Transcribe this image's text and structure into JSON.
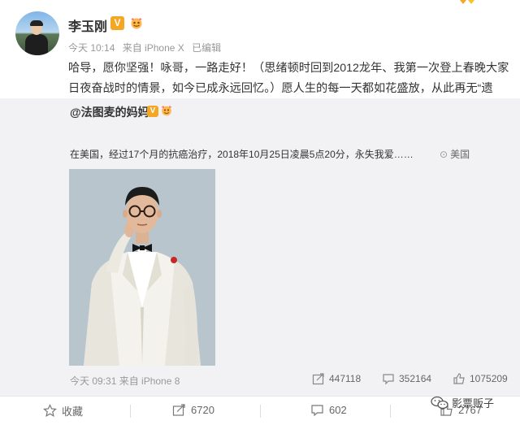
{
  "post": {
    "author": "李玉刚",
    "meta": {
      "time": "今天 10:14",
      "source": "来自 iPhone X",
      "edited": "已编辑"
    },
    "text": "哈导，愿你坚强！咏哥，一路走好！（思绪顿时回到2012龙年、我第一次登上春晚大家日夜奋战时的情景，如今已成永远回忆。）愿人生的每一天都如花盛放，从此再无“遗憾”二字。感恩所有！",
    "emojis": [
      "cry-emoji",
      "weep-emoji",
      "heart-emoji",
      "candle-emoji",
      "rose-emoji"
    ]
  },
  "repost": {
    "author": "@法图麦的妈妈",
    "text": "在美国，经过17个月的抗癌治疗，2018年10月25日凌晨5点20分，永失我爱……",
    "location": "美国",
    "footer": "今天 09:31 来自 iPhone 8",
    "stats": {
      "shares": "447118",
      "comments": "352164",
      "likes": "1075209"
    }
  },
  "actions": {
    "favorite": "收藏",
    "share": "6720",
    "comment": "602",
    "like": "2767"
  },
  "watermark": "影票贩子",
  "colors": {
    "verified": "#f5a623",
    "repost_bg": "#f2f2f5",
    "meta": "#999999",
    "text": "#333333"
  }
}
